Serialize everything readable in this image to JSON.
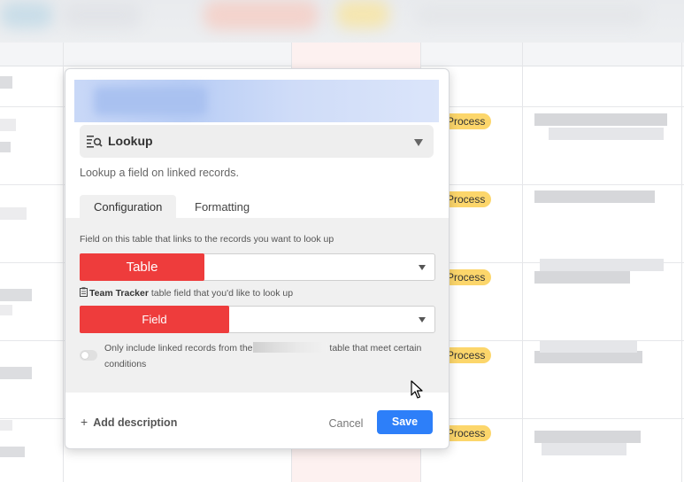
{
  "background": {
    "status_pill_label": "Process",
    "status_pill_color": "#fcd66b"
  },
  "dialog": {
    "field_type": {
      "label": "Lookup",
      "icon": "lookup-icon"
    },
    "description": "Lookup a field on linked records.",
    "tabs": [
      {
        "label": "Configuration",
        "active": true
      },
      {
        "label": "Formatting",
        "active": false
      }
    ],
    "config": {
      "link_field_label": "Field on this table that links to the records you want to look up",
      "link_field_value": "Table",
      "lookup_field_label_bold": "Team Tracker",
      "lookup_field_label_rest": " table field that you'd like to look up",
      "lookup_field_value": "Field",
      "condition_text_before": "Only include linked records from the",
      "condition_text_after": "table that meet certain conditions",
      "condition_enabled": false
    },
    "footer": {
      "add_description_label": "Add description",
      "cancel_label": "Cancel",
      "save_label": "Save"
    }
  },
  "colors": {
    "accent_blue": "#2d7ff9",
    "redaction_red": "#ee3c3c",
    "panel_gray": "#f0f0f0"
  }
}
